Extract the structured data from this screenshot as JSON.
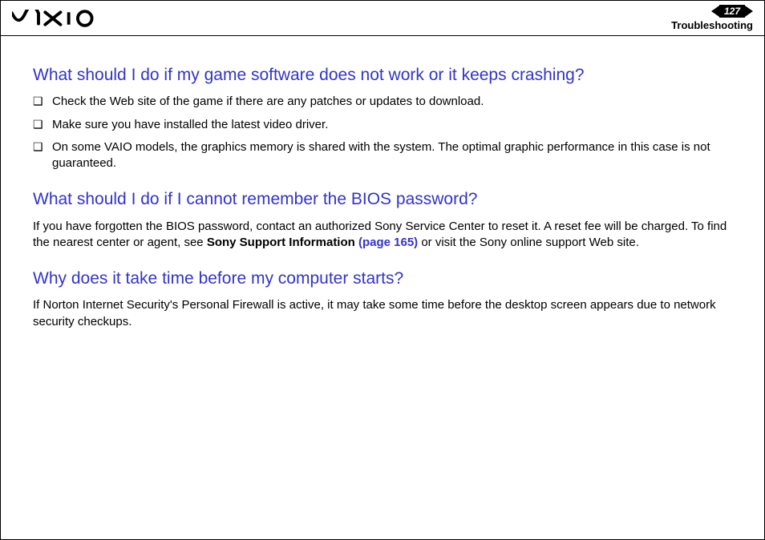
{
  "header": {
    "page_number": "127",
    "section": "Troubleshooting"
  },
  "q1": {
    "title": "What should I do if my game software does not work or it keeps crashing?",
    "bullets": [
      "Check the Web site of the game if there are any patches or updates to download.",
      "Make sure you have installed the latest video driver.",
      "On some VAIO models, the graphics memory is shared with the system. The optimal graphic performance in this case is not guaranteed."
    ]
  },
  "q2": {
    "title": "What should I do if I cannot remember the BIOS password?",
    "para_pre": "If you have forgotten the BIOS password, contact an authorized Sony Service Center to reset it. A reset fee will be charged. To find the nearest center or agent, see ",
    "link_bold": "Sony Support Information ",
    "link_ref": "(page 165)",
    "para_post": " or visit the Sony online support Web site."
  },
  "q3": {
    "title": "Why does it take time before my computer starts?",
    "para": "If Norton Internet Security's Personal Firewall is active, it may take some time before the desktop screen appears due to network security checkups."
  }
}
